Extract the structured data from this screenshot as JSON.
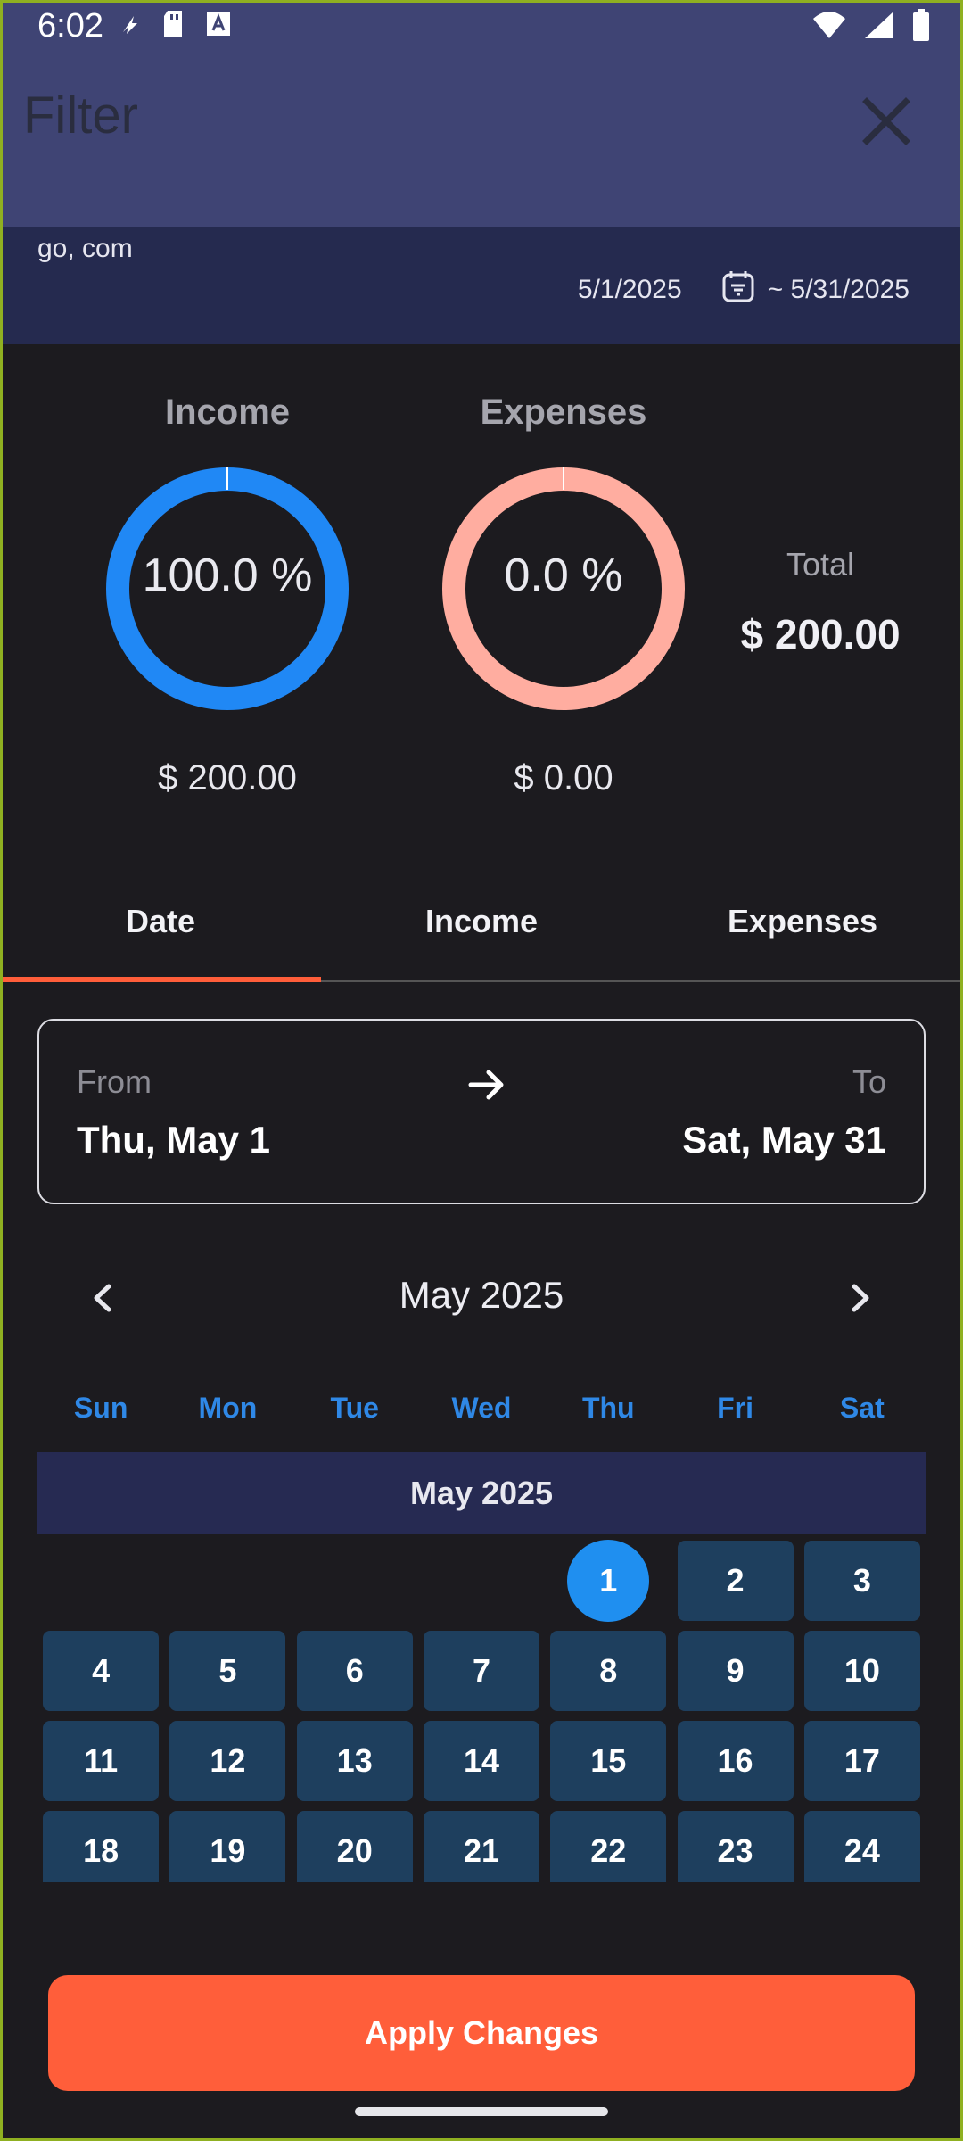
{
  "status": {
    "time": "6:02"
  },
  "header": {
    "title": "Filter",
    "search_text": "go, com",
    "date_start": "5/1/2025",
    "date_end": "~ 5/31/2025"
  },
  "summary": {
    "income": {
      "label": "Income",
      "percent_text": "100.0 %",
      "amount": "$ 200.00",
      "percent": 100,
      "color": "#2088f5"
    },
    "expenses": {
      "label": "Expenses",
      "percent_text": "0.0 %",
      "amount": "$ 0.00",
      "percent": 0,
      "color": "#ffada0"
    },
    "total": {
      "label": "Total",
      "amount": "$ 200.00"
    }
  },
  "tabs": [
    {
      "label": "Date",
      "active": true
    },
    {
      "label": "Income",
      "active": false
    },
    {
      "label": "Expenses",
      "active": false
    }
  ],
  "range": {
    "from_label": "From",
    "from_value": "Thu, May 1",
    "to_label": "To",
    "to_value": "Sat, May 31"
  },
  "calendar": {
    "month_title": "May 2025",
    "band_title": "May 2025",
    "weekdays": [
      "Sun",
      "Mon",
      "Tue",
      "Wed",
      "Thu",
      "Fri",
      "Sat"
    ],
    "first_weekday": 4,
    "visible_days": [
      1,
      2,
      3,
      4,
      5,
      6,
      7,
      8,
      9,
      10,
      11,
      12,
      13,
      14,
      15,
      16,
      17,
      18,
      19,
      20,
      21,
      22,
      23,
      24
    ],
    "selected_day": 1
  },
  "apply_label": "Apply Changes"
}
